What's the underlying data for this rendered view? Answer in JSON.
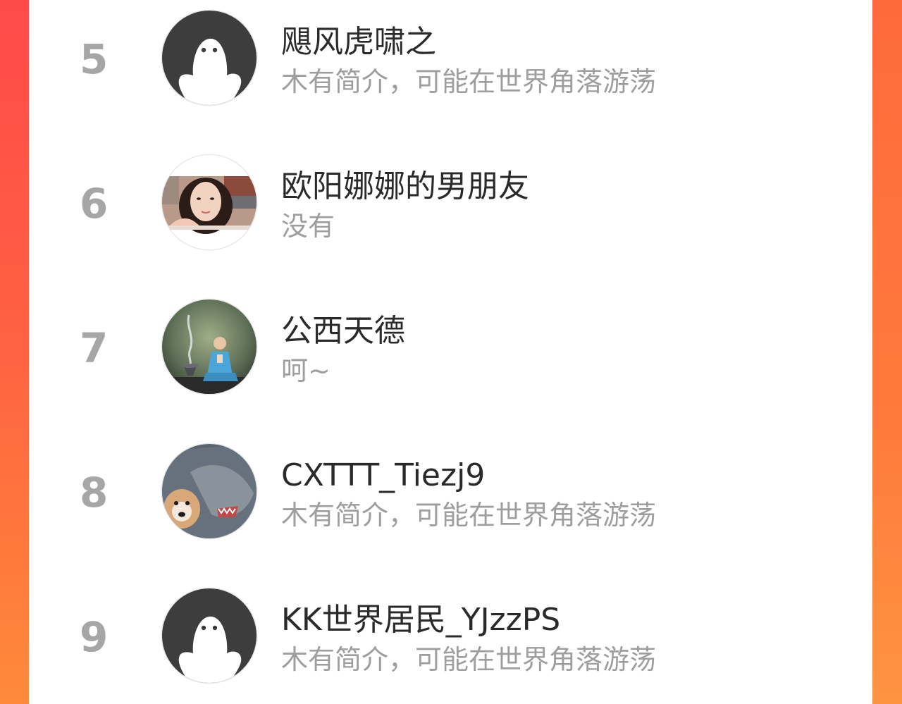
{
  "ranking_list": {
    "items": [
      {
        "rank": "5",
        "name": "飓风虎啸之",
        "bio": "木有简介，可能在世界角落游荡",
        "avatar_icon": "default-user-icon"
      },
      {
        "rank": "6",
        "name": "欧阳娜娜的男朋友",
        "bio": "没有",
        "avatar_icon": "photo-avatar-girl"
      },
      {
        "rank": "7",
        "name": "公西天德",
        "bio": "呵~",
        "avatar_icon": "photo-avatar-monk"
      },
      {
        "rank": "8",
        "name": "CXTTT_Tiezj9",
        "bio": "木有简介，可能在世界角落游荡",
        "avatar_icon": "photo-avatar-dog-shark"
      },
      {
        "rank": "9",
        "name": "KK世界居民_YJzzPS",
        "bio": "木有简介，可能在世界角落游荡",
        "avatar_icon": "default-user-icon"
      }
    ]
  },
  "colors": {
    "background_gradient_start": "#ff4a4a",
    "background_gradient_end": "#ff8a3a",
    "panel": "#ffffff",
    "rank_text": "#a6a6a6",
    "name_text": "#2a2a2a",
    "bio_text": "#9e9e9e"
  }
}
